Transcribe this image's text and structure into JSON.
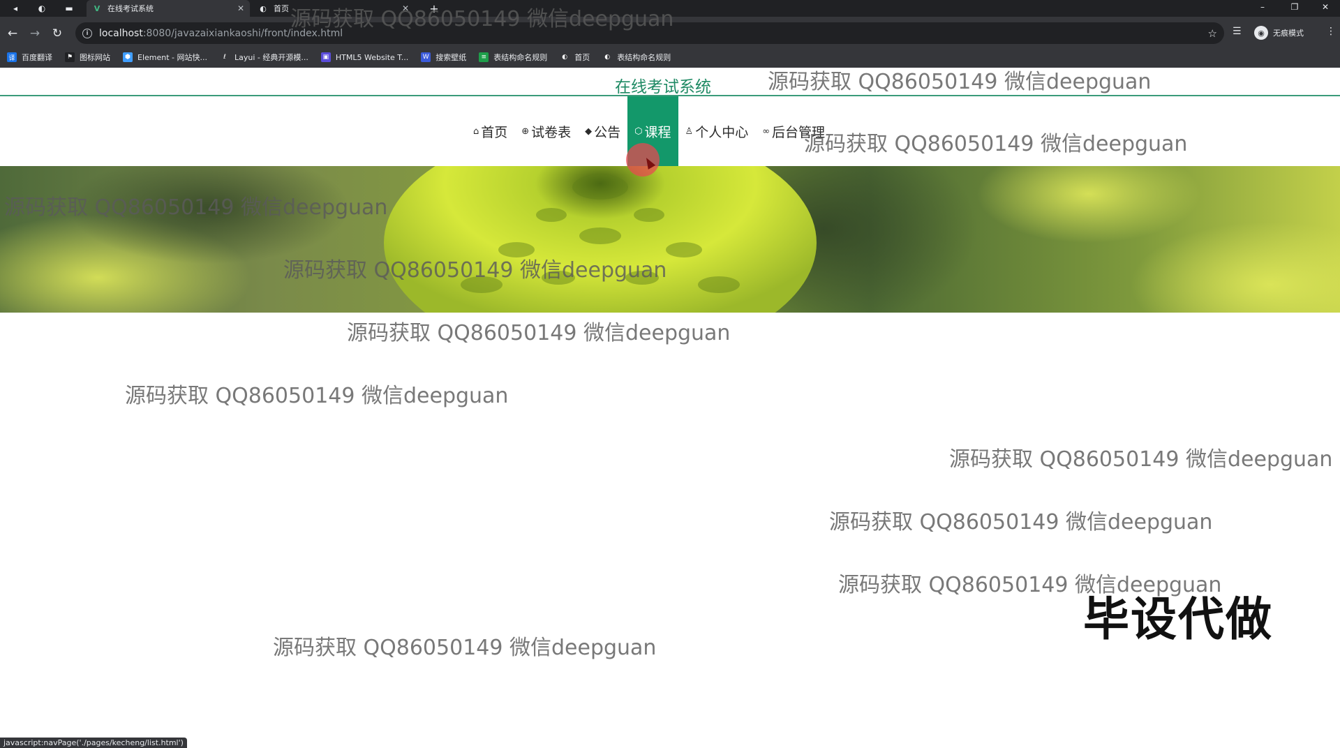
{
  "browser": {
    "tabs": [
      {
        "label": "在线考试系统",
        "active": true
      },
      {
        "label": "首页",
        "active": false
      }
    ],
    "url_host": "localhost",
    "url_path": ":8080/javazaixiankaoshi/front/index.html",
    "bookmarks": [
      {
        "label": "百度翻译",
        "color": "#1a73e8",
        "glyph": "译"
      },
      {
        "label": "图标网站",
        "color": "#202124",
        "glyph": "⚑"
      },
      {
        "label": "Element - 网站快...",
        "color": "#409eff",
        "glyph": "⬢"
      },
      {
        "label": "Layui - 经典开源模...",
        "color": "#35363a",
        "glyph": "ℓ"
      },
      {
        "label": "HTML5 Website T...",
        "color": "#5b4ddb",
        "glyph": "▣"
      },
      {
        "label": "搜索壁纸",
        "color": "#3b5bdb",
        "glyph": "W"
      },
      {
        "label": "表结构命名规则",
        "color": "#1e9e4a",
        "glyph": "≡"
      },
      {
        "label": "首页",
        "color": "#35363a",
        "glyph": "◐"
      },
      {
        "label": "表结构命名规则",
        "color": "#35363a",
        "glyph": "◐"
      }
    ],
    "profile_label": "无痕模式",
    "status_text": "javascript:navPage('./pages/kecheng/list.html')"
  },
  "site": {
    "title": "在线考试系统",
    "nav": [
      {
        "label": "首页",
        "icon": "home-icon",
        "glyph": "⌂",
        "active": false
      },
      {
        "label": "试卷表",
        "icon": "globe-icon",
        "glyph": "⊕",
        "active": false
      },
      {
        "label": "公告",
        "icon": "graduation-cap-icon",
        "glyph": "◆",
        "active": false
      },
      {
        "label": "课程",
        "icon": "hexagon-icon",
        "glyph": "⬡",
        "active": true
      },
      {
        "label": "个人中心",
        "icon": "user-icon",
        "glyph": "♙",
        "active": false
      },
      {
        "label": "后台管理",
        "icon": "link-icon",
        "glyph": "∞",
        "active": false
      }
    ],
    "accent_color": "#13986a"
  },
  "watermark_text": "源码获取 QQ86050149 微信deepguan",
  "stamp_text": "毕设代做"
}
